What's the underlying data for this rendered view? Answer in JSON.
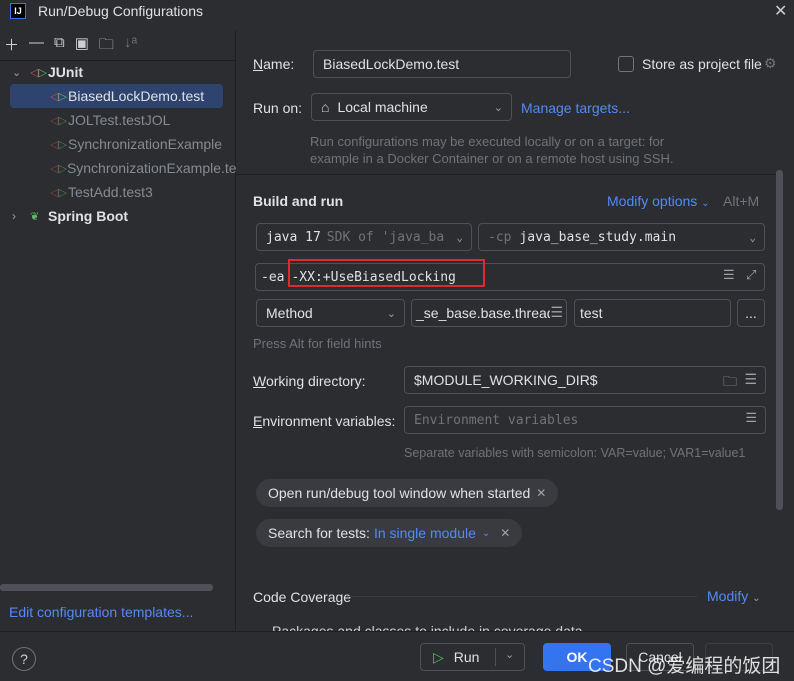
{
  "window": {
    "title": "Run/Debug Configurations",
    "logo": "IJ"
  },
  "toolbar": {
    "icons": [
      "plus-icon",
      "minus-icon",
      "copy-icon",
      "save-icon",
      "folder-add-icon",
      "sort-icon"
    ]
  },
  "tree": {
    "groups": [
      {
        "label": "JUnit",
        "expanded": true,
        "items": [
          "BiasedLockDemo.test",
          "JOLTest.testJOL",
          "SynchronizationExample",
          "SynchronizationExample.test",
          "TestAdd.test3"
        ]
      },
      {
        "label": "Spring Boot",
        "expanded": false
      }
    ],
    "selected": "BiasedLockDemo.test"
  },
  "sidebar": {
    "edit_templates": "Edit configuration templates..."
  },
  "form": {
    "name_label": "Name:",
    "name_value": "BiasedLockDemo.test",
    "store_label": "Store as project file",
    "store_checked": false,
    "run_on_label": "Run on:",
    "run_on_value": "Local machine",
    "manage_targets": "Manage targets...",
    "run_on_hint": "Run configurations may be executed locally or on a target: for example in a Docker Container or on a remote host using SSH.",
    "build_title": "Build and run",
    "modify_options": "Modify options",
    "modify_shortcut": "Alt+M",
    "jdk_main": "java 17",
    "jdk_sub": "SDK of 'java_ba",
    "cp_prefix": "-cp",
    "cp_value": "java_base_study.main",
    "vm_prefix": "-ea",
    "vm_value": "-XX:+UseBiasedLocking",
    "highlight_color": "#e0282e",
    "test_kind": "Method",
    "class_value": "_se_base.base.thread.",
    "method_value": "test",
    "more": "...",
    "field_hints": "Press Alt for field hints",
    "workdir_label": "Working directory:",
    "workdir_value": "$MODULE_WORKING_DIR$",
    "env_label": "Environment variables:",
    "env_placeholder": "Environment variables",
    "env_hint": "Separate variables with semicolon: VAR=value; VAR1=value1",
    "chip1": "Open run/debug tool window when started",
    "chip2_label": "Search for tests:",
    "chip2_value": "In single module",
    "coverage_title": "Code Coverage",
    "coverage_modify": "Modify",
    "coverage_sub": "Packages and classes to include in coverage data"
  },
  "footer": {
    "run": "Run",
    "ok": "OK",
    "cancel": "Cancel",
    "help": "?"
  },
  "watermark": "CSDN @爱编程的饭团",
  "colors": {
    "accent": "#3574f0",
    "link": "#548af7",
    "selected": "#2e436e"
  }
}
